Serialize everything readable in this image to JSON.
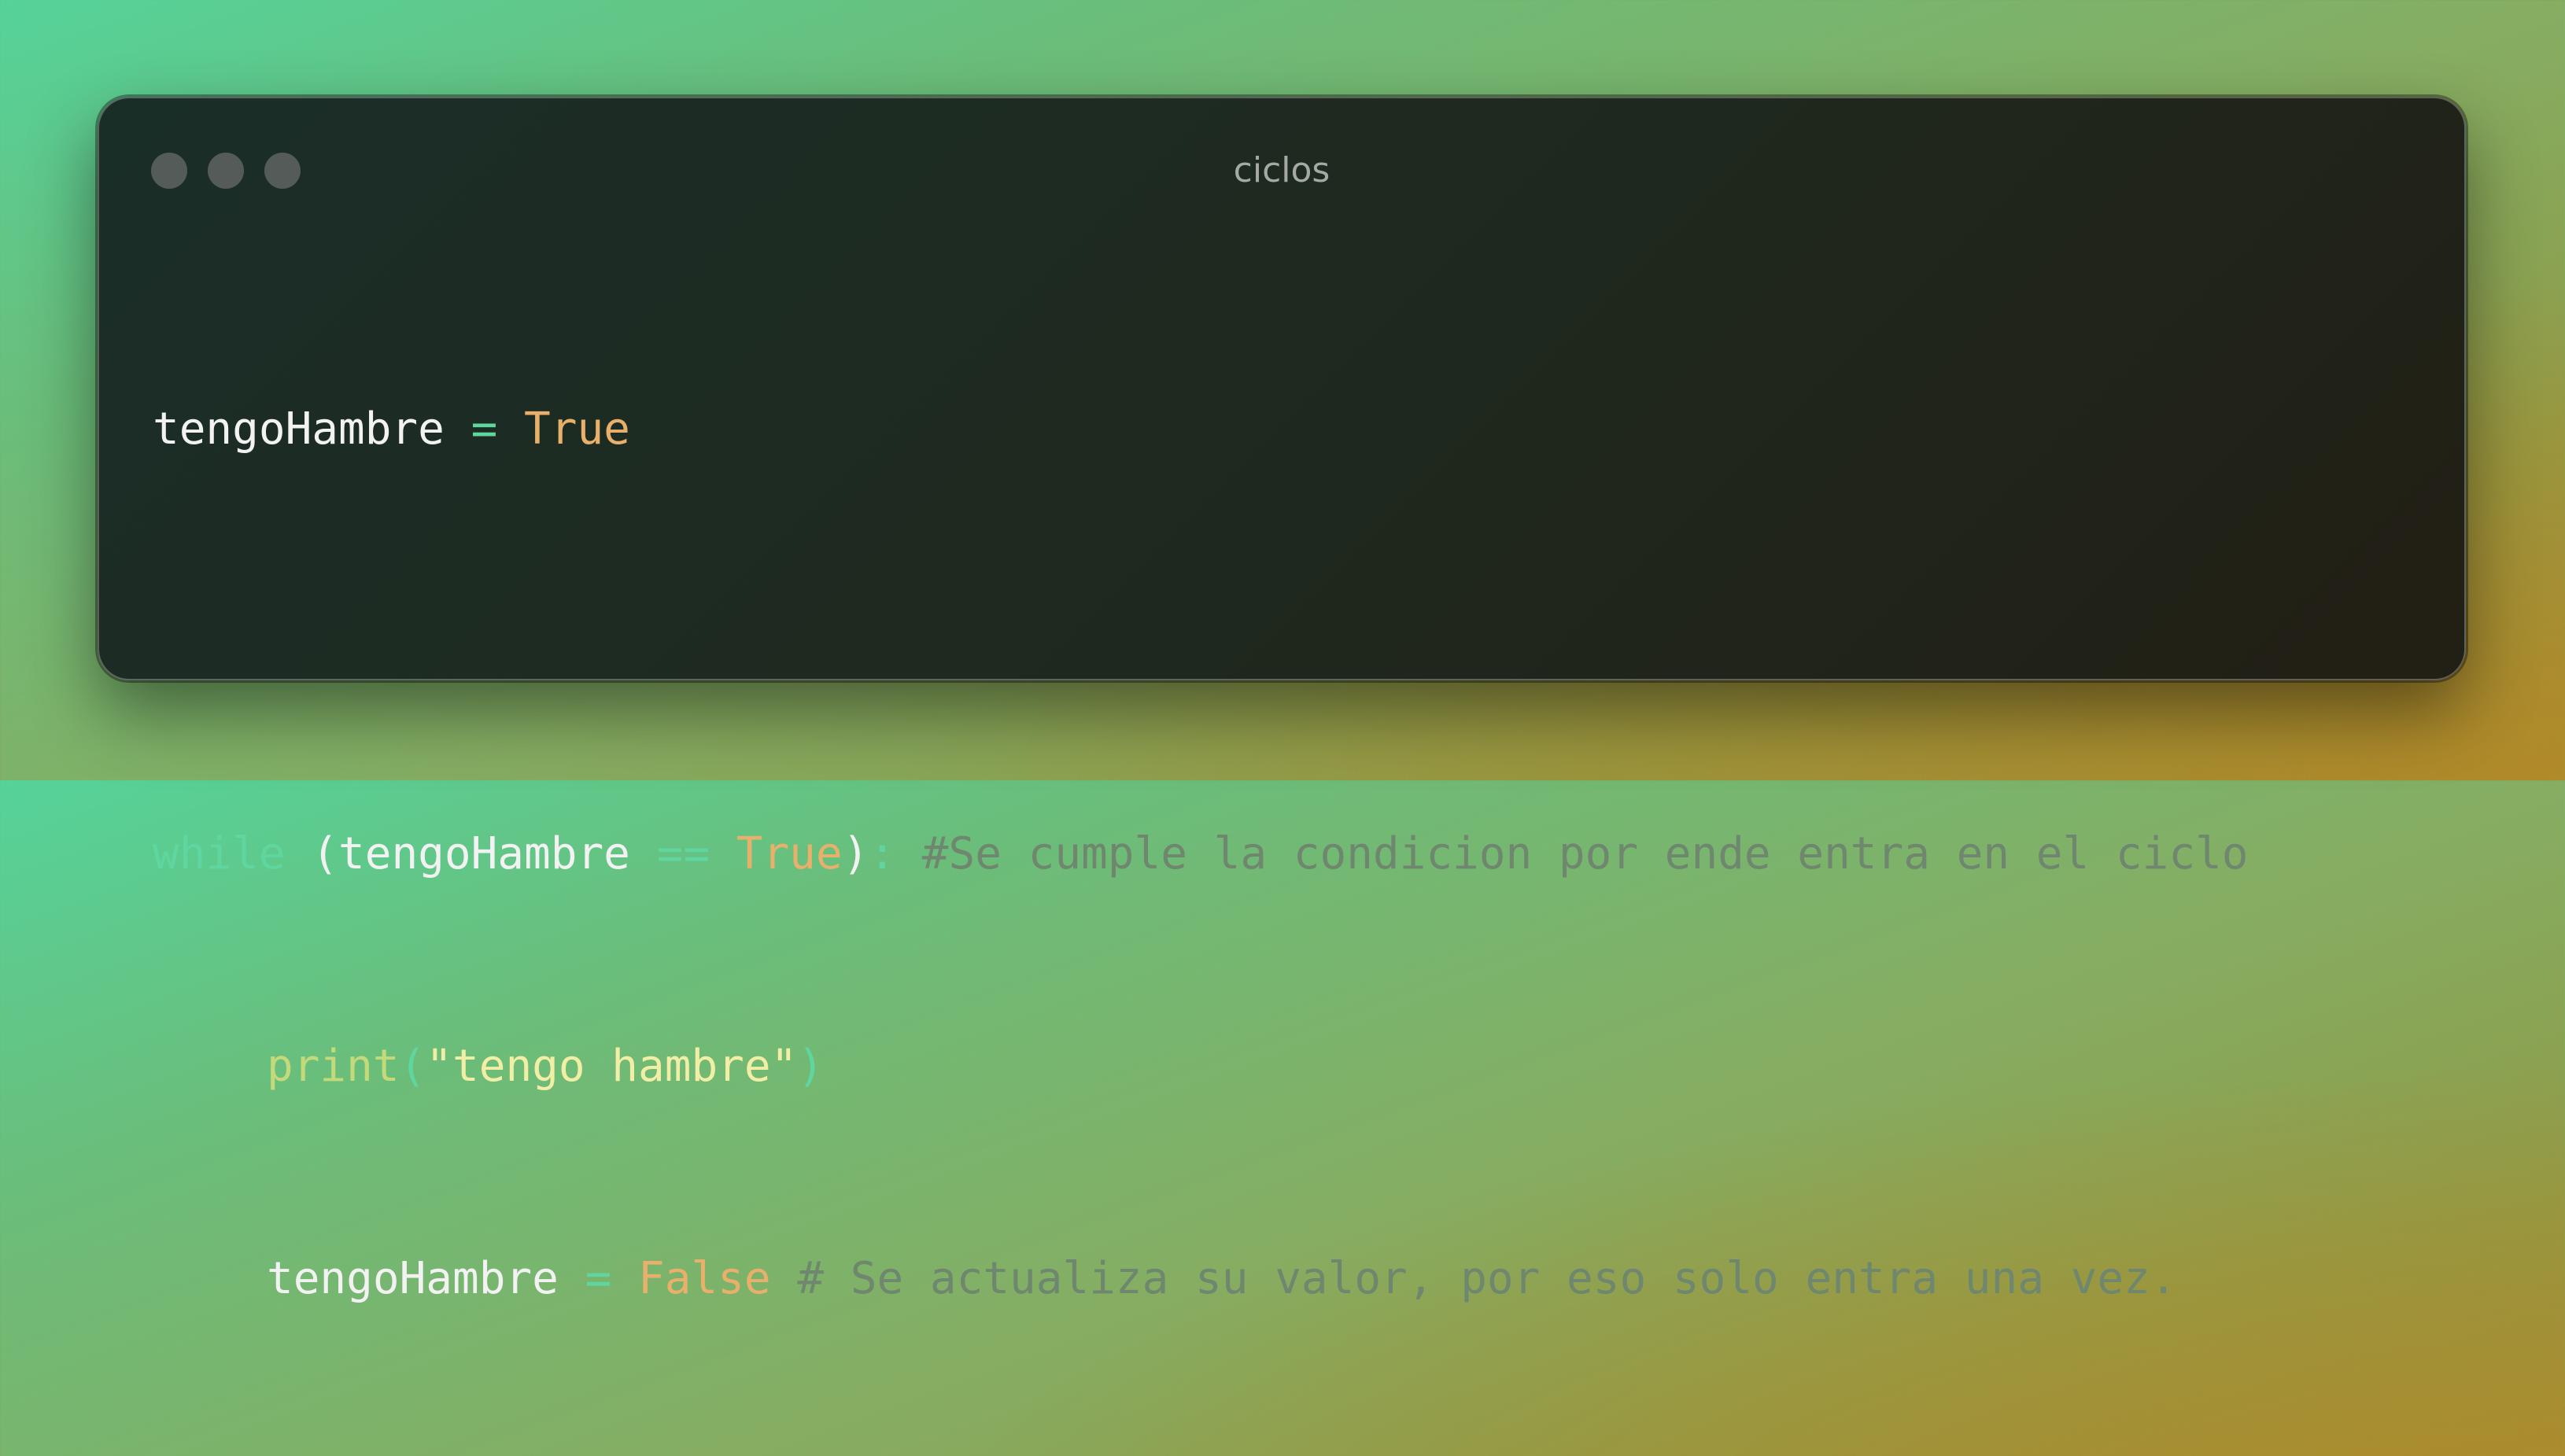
{
  "window": {
    "title": "ciclos"
  },
  "code": {
    "line1": {
      "var": "tengoHambre",
      "op": " = ",
      "value": "True"
    },
    "line2": {
      "keyword": "while",
      "space": " ",
      "open": "(",
      "var": "tengoHambre",
      "op": " == ",
      "value": "True",
      "close": ")",
      "colon": ":",
      "comment": " #Se cumple la condicion por ende entra en el ciclo"
    },
    "line3": {
      "func": "print",
      "open": "(",
      "string": "\"tengo hambre\"",
      "close": ")"
    },
    "line4": {
      "var": "tengoHambre",
      "op": " = ",
      "value": "False",
      "comment": " # Se actualiza su valor, por eso solo entra una vez."
    }
  },
  "colors": {
    "keyword": "#5fd6a0",
    "boolean": "#e8b06a",
    "function": "#c3d97a",
    "string": "#f2eea6",
    "comment": "#6e876e",
    "window_bg": "#1e2a20"
  }
}
